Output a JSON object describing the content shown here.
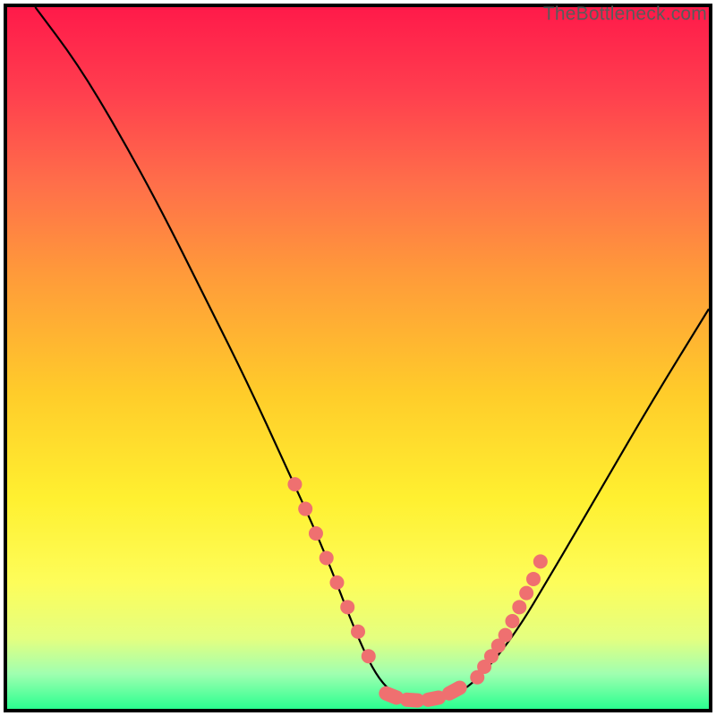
{
  "attribution": "TheBottleneck.com",
  "chart_data": {
    "type": "line",
    "title": "",
    "xlabel": "",
    "ylabel": "",
    "xlim": [
      0,
      100
    ],
    "ylim": [
      0,
      100
    ],
    "series": [
      {
        "name": "bottleneck-curve",
        "x": [
          4,
          10,
          16,
          22,
          28,
          34,
          40,
          45,
          50,
          53,
          56,
          59,
          62,
          66,
          72,
          78,
          85,
          92,
          100
        ],
        "y": [
          100,
          92,
          82,
          71,
          59,
          47,
          34,
          23,
          10,
          4,
          1.5,
          1,
          1.5,
          3,
          10,
          20,
          32,
          44,
          57
        ]
      },
      {
        "name": "highlight-left",
        "x": [
          41,
          42.5,
          44,
          45.5,
          47,
          48.5,
          50,
          51.5
        ],
        "y": [
          32,
          28.5,
          25,
          21.5,
          18,
          14.5,
          11,
          7.5
        ]
      },
      {
        "name": "highlight-bottom",
        "x": [
          54,
          55.5,
          57,
          58.5,
          60,
          61.5,
          63,
          64.5
        ],
        "y": [
          2.2,
          1.6,
          1.3,
          1.2,
          1.3,
          1.6,
          2.2,
          3
        ],
        "groups": [
          [
            0,
            1
          ],
          [
            2,
            3
          ],
          [
            4,
            5
          ],
          [
            6,
            7
          ]
        ]
      },
      {
        "name": "highlight-right",
        "x": [
          67,
          68,
          69,
          70,
          71,
          72,
          73,
          74,
          75,
          76
        ],
        "y": [
          4.5,
          6,
          7.5,
          9,
          10.5,
          12.5,
          14.5,
          16.5,
          18.5,
          21
        ]
      }
    ],
    "legend": null,
    "grid": false
  },
  "colors": {
    "curve": "#000000",
    "highlight": "#ef7070"
  }
}
